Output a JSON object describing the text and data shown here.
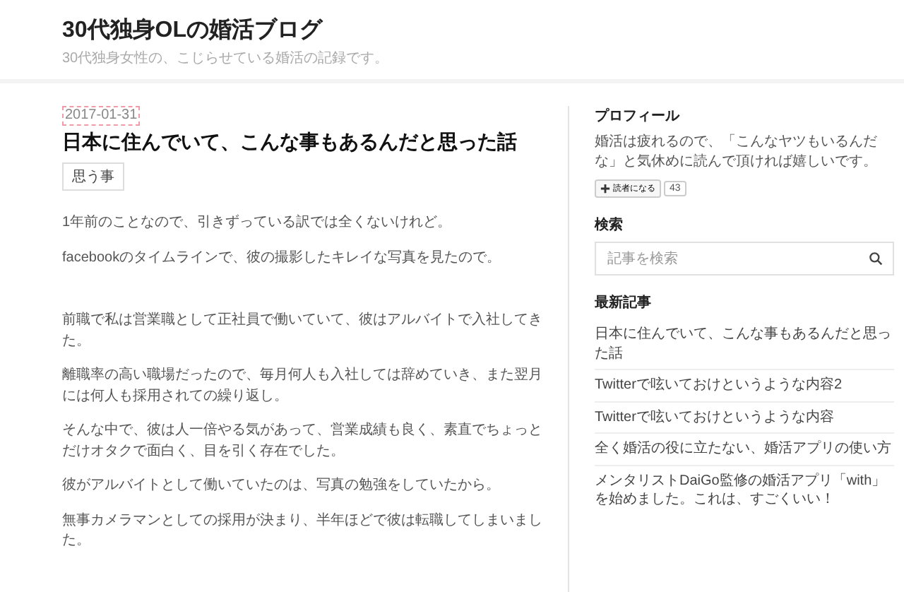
{
  "header": {
    "title": "30代独身OLの婚活ブログ",
    "tagline": "30代独身女性の、こじらせている婚活の記録です。"
  },
  "article": {
    "date": "2017-01-31",
    "title": "日本に住んでいて、こんな事もあるんだと思った話",
    "category": "思う事",
    "paragraphs": [
      {
        "kind": "text",
        "text": "1年前のことなので、引きずっている訳では全くないけれど。"
      },
      {
        "kind": "text",
        "text": "facebookのタイムラインで、彼の撮影したキレイな写真を見たので。"
      },
      {
        "kind": "spacer"
      },
      {
        "kind": "text",
        "text": "前職で私は営業職として正社員で働いていて、彼はアルバイトで入社してきた。"
      },
      {
        "kind": "text",
        "text": "離職率の高い職場だったので、毎月何人も入社しては辞めていき、また翌月には何人も採用されての繰り返し。"
      },
      {
        "kind": "text",
        "text": "そんな中で、彼は人一倍やる気があって、営業成績も良く、素直でちょっとだけオタクで面白く、目を引く存在でした。"
      },
      {
        "kind": "text",
        "text": "彼がアルバイトとして働いていたのは、写真の勉強をしていたから。"
      },
      {
        "kind": "text",
        "text": "無事カメラマンとしての採用が決まり、半年ほどで彼は転職してしまいました。"
      }
    ]
  },
  "sidebar": {
    "profile": {
      "heading": "プロフィール",
      "text": "婚活は疲れるので、「こんなヤツもいるんだな」と気休めに読んで頂ければ嬉しいです。",
      "follow_label": "読者になる",
      "follow_count": "43"
    },
    "search": {
      "heading": "検索",
      "placeholder": "記事を検索"
    },
    "recent": {
      "heading": "最新記事",
      "items": [
        "日本に住んでいて、こんな事もあるんだと思った話",
        "Twitterで呟いておけというような内容2",
        "Twitterで呟いておけというような内容",
        "全く婚活の役に立たない、婚活アプリの使い方",
        "メンタリストDaiGo監修の婚活アプリ「with」を始めました。これは、すごくいい！"
      ]
    }
  }
}
